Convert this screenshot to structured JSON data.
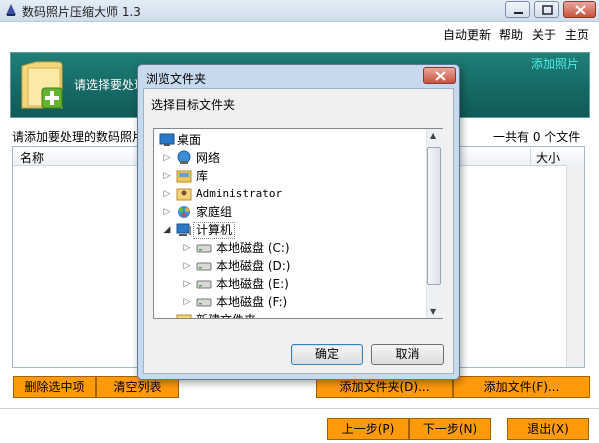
{
  "window": {
    "title": "数码照片压缩大师 1.3"
  },
  "menu": {
    "items": [
      "自动更新",
      "帮助",
      "关于",
      "主页"
    ]
  },
  "banner": {
    "text": "请选择要处理",
    "add_photo_link": "添加照片"
  },
  "list": {
    "hint": "请添加要处理的数码照片",
    "count_text": "一共有 0 个文件",
    "columns": {
      "name": "名称",
      "size": "大小"
    }
  },
  "buttons": {
    "delete_selected": "删除选中项",
    "clear_list": "清空列表",
    "add_folder": "添加文件夹(D)...",
    "add_file": "添加文件(F)...",
    "prev": "上一步(P)",
    "next": "下一步(N)",
    "exit": "退出(X)"
  },
  "dialog": {
    "title": "浏览文件夹",
    "prompt": "选择目标文件夹",
    "tree": [
      {
        "label": "桌面",
        "icon": "desktop-icon"
      },
      {
        "label": "网络",
        "icon": "network-icon"
      },
      {
        "label": "库",
        "icon": "library-icon"
      },
      {
        "label": "Administrator",
        "icon": "user-folder-icon"
      },
      {
        "label": "家庭组",
        "icon": "homegroup-icon"
      },
      {
        "label": "计算机",
        "icon": "computer-icon"
      },
      {
        "label": "本地磁盘 (C:)",
        "icon": "drive-icon"
      },
      {
        "label": "本地磁盘 (D:)",
        "icon": "drive-icon"
      },
      {
        "label": "本地磁盘 (E:)",
        "icon": "drive-icon"
      },
      {
        "label": "本地磁盘 (F:)",
        "icon": "drive-icon"
      },
      {
        "label": "新建文件夹",
        "icon": "folder-icon"
      }
    ],
    "ok": "确定",
    "cancel": "取消"
  }
}
